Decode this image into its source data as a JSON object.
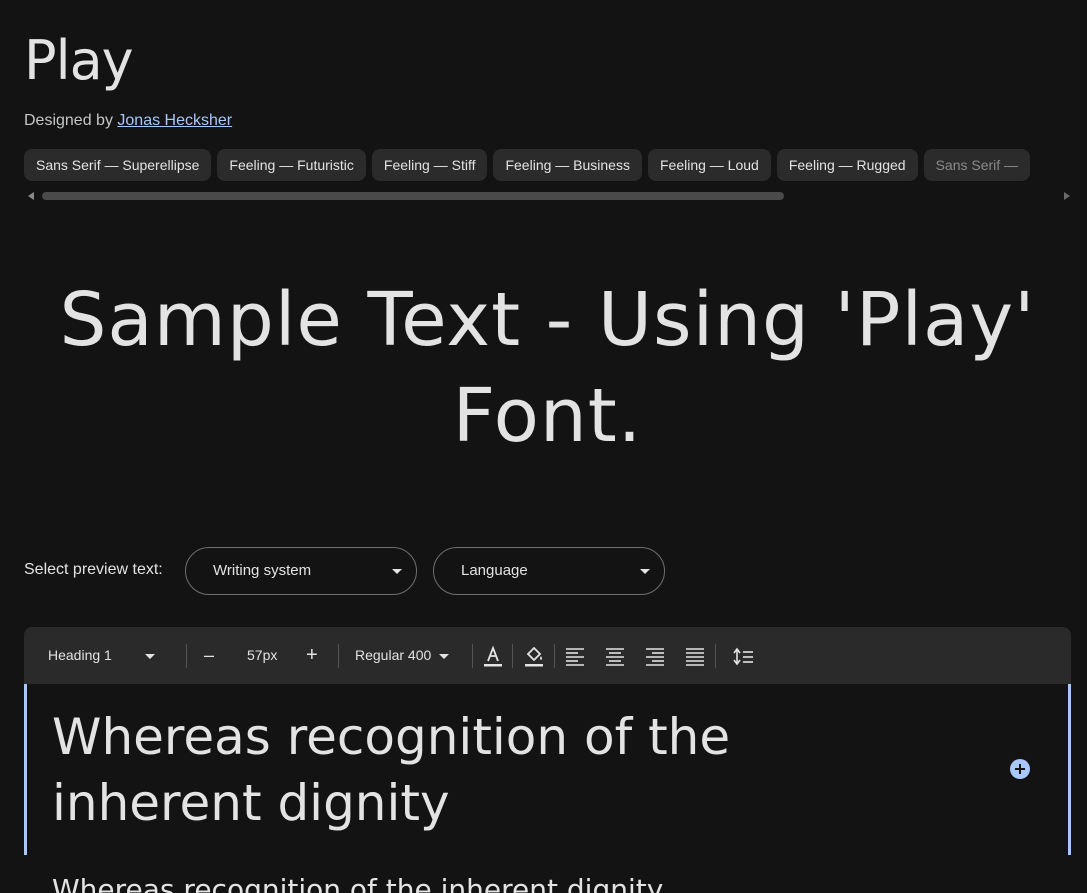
{
  "family": {
    "name": "Play",
    "designed_by_label": "Designed by",
    "designer": "Jonas Hecksher"
  },
  "tags": [
    "Sans Serif — Superellipse",
    "Feeling — Futuristic",
    "Feeling — Stiff",
    "Feeling — Business",
    "Feeling — Loud",
    "Feeling — Rugged",
    "Sans Serif —"
  ],
  "hero": {
    "sample_text": "Sample Text - Using 'Play' Font."
  },
  "preview": {
    "label": "Select preview text:",
    "writing_system": "Writing system",
    "language": "Language"
  },
  "toolbar": {
    "style": "Heading 1",
    "decrease": "–",
    "size": "57px",
    "increase": "+",
    "weight": "Regular 400",
    "icons": [
      "text-color-icon",
      "highlight-color-icon",
      "align-left-icon",
      "align-center-icon",
      "align-right-icon",
      "align-justify-icon",
      "line-height-icon"
    ]
  },
  "editor": {
    "heading": "Whereas recognition of the inherent dignity",
    "body": "Whereas recognition of the inherent dignity"
  },
  "colors": {
    "background": "#131313",
    "accent": "#a8c7fa",
    "chip": "#2b2b2b",
    "toolbar": "#2a2a2a"
  }
}
